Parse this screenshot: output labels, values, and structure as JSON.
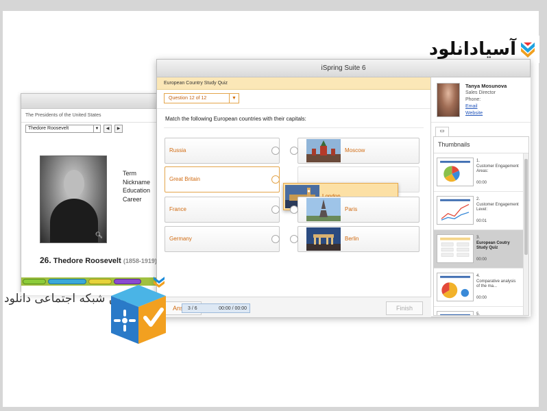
{
  "logo_text": "آسیادانلود",
  "watermark_text": "نخستین شبکه اجتماعی دانلود",
  "back_window": {
    "crumb": "The Presidents of the United States",
    "selected_president": "Thedore Roosevelt",
    "prev_label": "◀",
    "next_label": "▶",
    "fields": [
      "Term",
      "Nickname",
      "Education",
      "Career"
    ],
    "number": "26.",
    "name": "Thedore Roosevelt",
    "years": "(1858-1919)"
  },
  "main_window": {
    "title": "iSpring Suite 6",
    "quiz_title": "European Country Study Quiz",
    "question_label": "Question 12 of 12",
    "instruction": "Match the following European countries with their capitals:",
    "rows": [
      {
        "country": "Russia",
        "capital": "Moscow"
      },
      {
        "country": "Great Britain",
        "capital": "London"
      },
      {
        "country": "France",
        "capital": "Paris"
      },
      {
        "country": "Germany",
        "capital": "Berlin"
      }
    ],
    "answer_label": "Answer",
    "finish_label": "Finish",
    "progress_pages": "3 / 6",
    "progress_time": "00:00 / 00:00"
  },
  "sidebar": {
    "presenter_name": "Tanya Mosunova",
    "presenter_role": "Sales Director",
    "phone_label": "Phone:",
    "email_label": "Email",
    "website_label": "Website",
    "thumbnails_title": "Thumbnails",
    "thumbnails": [
      {
        "index": "1.",
        "title": "Customer Engagement Areas:",
        "duration": "00:00"
      },
      {
        "index": "2.",
        "title": "Customer Engagement Level:",
        "duration": "00:01"
      },
      {
        "index": "3.",
        "title": "European Coutry Study Quiz",
        "duration": "00:00"
      },
      {
        "index": "4.",
        "title": "Comparative analysis of the ma...",
        "duration": "00:00"
      },
      {
        "index": "5.",
        "title": "",
        "duration": ""
      }
    ]
  },
  "colors": {
    "accent_orange": "#d06a10",
    "quiz_header_bg": "#fbe7b7",
    "drag_card_bg": "#fce0a5",
    "link_blue": "#2255bb",
    "timeline_green": "#a0c040"
  }
}
